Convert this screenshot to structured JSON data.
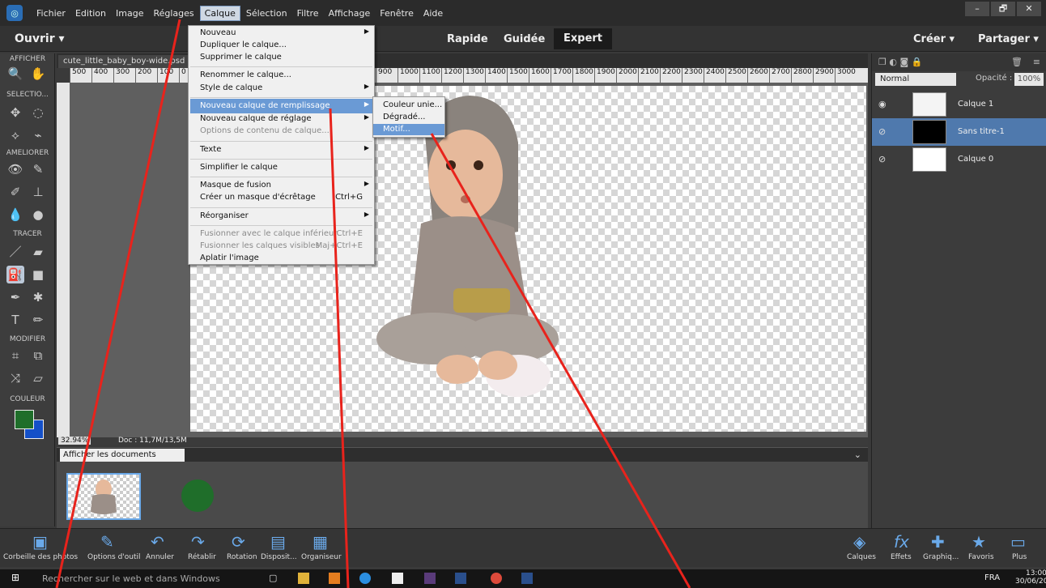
{
  "menubar": {
    "items": [
      "Fichier",
      "Edition",
      "Image",
      "Réglages",
      "Calque",
      "Sélection",
      "Filtre",
      "Affichage",
      "Fenêtre",
      "Aide"
    ],
    "window_controls": [
      "–",
      "🗗",
      "✕"
    ]
  },
  "modebar": {
    "open_label": "Ouvrir",
    "modes": [
      "Rapide",
      "Guidée",
      "Expert"
    ],
    "create_label": "Créer",
    "share_label": "Partager"
  },
  "toolbox": {
    "sections": [
      "AFFICHER",
      "SELECTIO...",
      "AMELIORER",
      "TRACER",
      "MODIFIER",
      "COULEUR"
    ]
  },
  "document": {
    "tab_title": "cute_little_baby_boy-wide.psd @ 32,9% (RVB/8) * ×",
    "ruler_labels": [
      "500",
      "400",
      "300",
      "200",
      "100",
      "0",
      "100",
      "200",
      "300",
      "400",
      "500",
      "600",
      "700",
      "800",
      "900",
      "1000",
      "1100",
      "1200",
      "1300",
      "1400",
      "1500",
      "1600",
      "1700",
      "1800",
      "1900",
      "2000",
      "2100",
      "2200",
      "2300",
      "2400",
      "2500",
      "2600",
      "2700",
      "2800",
      "2900",
      "3000"
    ],
    "zoom": "32.94%",
    "doc_size": "Doc : 11,7M/13,5M"
  },
  "bin": {
    "selector": "Afficher les documents ouve..."
  },
  "layers_panel": {
    "blend_mode": "Normal",
    "opacity_label": "Opacité :",
    "opacity_value": "100%",
    "layers": [
      {
        "name": "Calque 1",
        "visible": true,
        "selected": false
      },
      {
        "name": "Sans titre-1",
        "visible": false,
        "selected": true
      },
      {
        "name": "Calque 0",
        "visible": false,
        "selected": false
      }
    ]
  },
  "calque_menu": {
    "items": [
      {
        "label": "Nouveau",
        "submenu": true
      },
      {
        "label": "Dupliquer le calque..."
      },
      {
        "label": "Supprimer le calque"
      },
      {
        "label": "Renommer le calque..."
      },
      {
        "label": "Style de calque",
        "submenu": true
      },
      {
        "label": "Nouveau calque de remplissage",
        "submenu": true,
        "highlighted": true
      },
      {
        "label": "Nouveau calque de réglage",
        "submenu": true
      },
      {
        "label": "Options de contenu de calque...",
        "disabled": true
      },
      {
        "label": "Texte",
        "submenu": true
      },
      {
        "label": "Simplifier le calque"
      },
      {
        "label": "Masque de fusion",
        "submenu": true
      },
      {
        "label": "Créer un masque d'écrêtage",
        "shortcut": "Ctrl+G"
      },
      {
        "label": "Réorganiser",
        "submenu": true
      },
      {
        "label": "Fusionner avec le calque inférieur",
        "shortcut": "Ctrl+E",
        "disabled": true
      },
      {
        "label": "Fusionner les calques visibles",
        "shortcut": "Maj+Ctrl+E",
        "disabled": true
      },
      {
        "label": "Aplatir l'image"
      }
    ]
  },
  "fill_submenu": {
    "items": [
      "Couleur unie...",
      "Dégradé...",
      "Motif..."
    ]
  },
  "bottombar": {
    "items": [
      "Corbeille des photos",
      "Options d'outil",
      "Annuler",
      "Rétablir",
      "Rotation",
      "Disposit...",
      "Organiseur",
      "Calques",
      "Effets",
      "Graphiq...",
      "Favoris",
      "Plus"
    ]
  },
  "taskbar": {
    "search_placeholder": "Rechercher sur le web et dans Windows",
    "language": "FRA",
    "time": "13:00",
    "date": "30/06/2016"
  },
  "colors": {
    "foreground": "#1f6e2a",
    "background": "#1450c8",
    "highlight": "#6a9ad5",
    "annotation": "#e8231c"
  }
}
